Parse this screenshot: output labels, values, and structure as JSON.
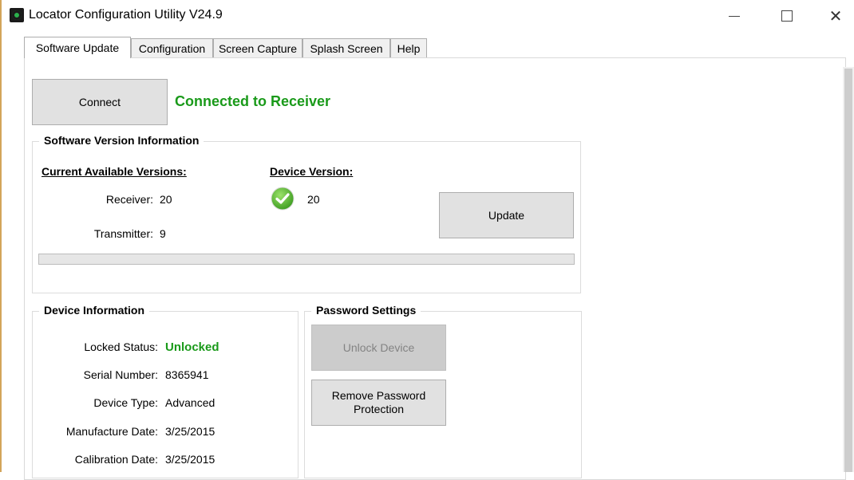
{
  "window": {
    "title": "Locator Configuration Utility V24.9",
    "close_glyph": "✕"
  },
  "tabs": [
    {
      "label": "Software Update"
    },
    {
      "label": "Configuration"
    },
    {
      "label": "Screen Capture"
    },
    {
      "label": "Splash Screen"
    },
    {
      "label": "Help"
    }
  ],
  "connect": {
    "button_label": "Connect",
    "status": "Connected to Receiver",
    "status_color": "#1a9a1a"
  },
  "software_version": {
    "title": "Software Version Information",
    "current_header": "Current Available Versions:",
    "device_header": "Device Version:",
    "receiver_label": "Receiver:",
    "receiver_value": "20",
    "transmitter_label": "Transmitter:",
    "transmitter_value": "9",
    "device_version_value": "20",
    "device_version_icon": "check-circle-icon",
    "update_button": "Update",
    "progress": 0
  },
  "device_info": {
    "title": "Device Information",
    "locked_status_label": "Locked Status:",
    "locked_status_value": "Unlocked",
    "serial_label": "Serial Number:",
    "serial_value": "8365941",
    "type_label": "Device Type:",
    "type_value": "Advanced",
    "manufacture_label": "Manufacture Date:",
    "manufacture_value": "3/25/2015",
    "calibration_label": "Calibration Date:",
    "calibration_value": "3/25/2015"
  },
  "password_settings": {
    "title": "Password Settings",
    "unlock_button": "Unlock Device",
    "remove_button_line1": "Remove Password",
    "remove_button_line2": "Protection"
  }
}
